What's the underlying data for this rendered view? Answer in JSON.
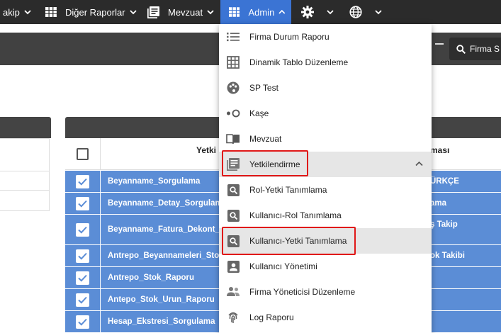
{
  "nav": {
    "items": [
      {
        "label": "akip",
        "icon": "none"
      },
      {
        "label": "Diğer Raporlar",
        "icon": "grid-icon"
      },
      {
        "label": "Mevzuat",
        "icon": "document-icon"
      },
      {
        "label": "Admin",
        "icon": "grid-icon",
        "active": true
      },
      {
        "label": "",
        "icon": "gear-icon"
      },
      {
        "label": "",
        "icon": "globe-icon"
      }
    ]
  },
  "search": {
    "label": "Firma S"
  },
  "table": {
    "col_name": "Yetki",
    "col_right": "ması",
    "rows": [
      {
        "name": "Beyanname_Sorgulama",
        "right": "ÜRKÇE"
      },
      {
        "name": "Beyanname_Detay_Sorgulama",
        "right": "ama"
      },
      {
        "name": "Beyanname_Fatura_Dekont_İş",
        "right": "ş Takip"
      },
      {
        "name": "Antrepo_Beyannameleri_Stok",
        "right": "ok Takibi"
      },
      {
        "name": "Antrepo_Stok_Raporu",
        "right": ""
      },
      {
        "name": "Antepo_Stok_Urun_Raporu",
        "right": ""
      },
      {
        "name": "Hesap_Ekstresi_Sorgulama",
        "right": ""
      }
    ]
  },
  "menu": {
    "items": [
      {
        "label": "Firma Durum Raporu",
        "icon": "list-icon"
      },
      {
        "label": "Dinamik Tablo Düzenleme",
        "icon": "table-icon"
      },
      {
        "label": "SP Test",
        "icon": "palette-icon"
      },
      {
        "label": "Kaşe",
        "icon": "toggle-dots-icon"
      },
      {
        "label": "Mevzuat",
        "icon": "book-icon"
      },
      {
        "label": "Yetkilendirme",
        "icon": "document-icon",
        "expanded": true
      },
      {
        "label": "Rol-Yetki Tanımlama",
        "icon": "search-box-icon"
      },
      {
        "label": "Kullanıcı-Rol Tanımlama",
        "icon": "search-box-icon"
      },
      {
        "label": "Kullanıcı-Yetki Tanımlama",
        "icon": "search-box-icon"
      },
      {
        "label": "Kullanıcı Yönetimi",
        "icon": "account-box-icon"
      },
      {
        "label": "Firma Yöneticisi Düzenleme",
        "icon": "people-icon"
      },
      {
        "label": "Log Raporu",
        "icon": "fingerprint-icon"
      }
    ]
  },
  "colors": {
    "nav_bg": "#2b2b2b",
    "active": "#3b74d4",
    "row_selected": "#5b8dd6",
    "highlight_border": "#e01818"
  }
}
